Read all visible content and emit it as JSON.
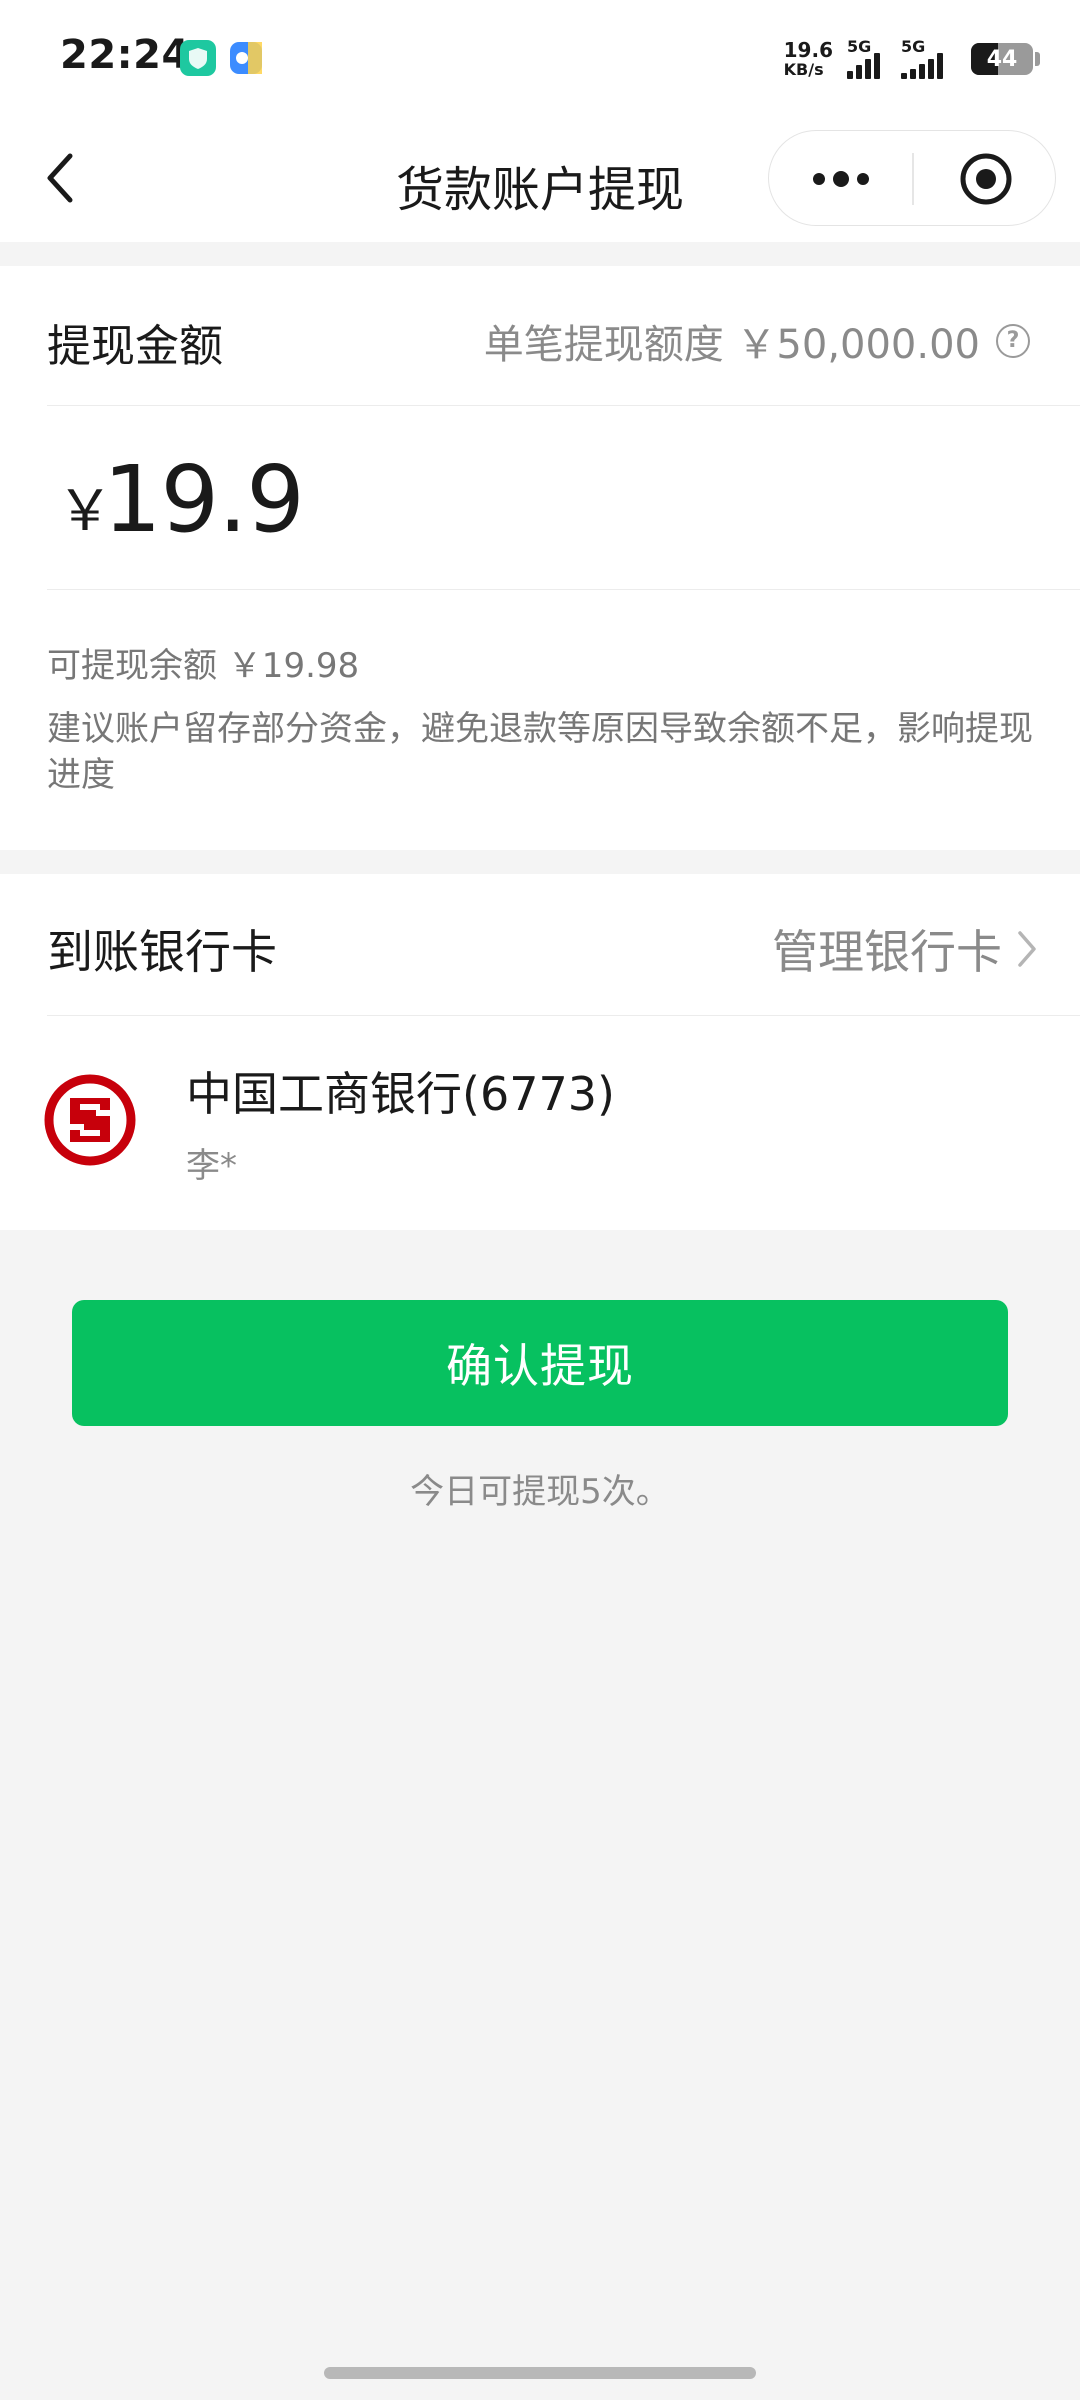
{
  "status_bar": {
    "time": "22:24",
    "net_speed_value": "19.6",
    "net_speed_unit": "KB/s",
    "sim1_label": "5G",
    "sim2_label": "5G",
    "battery_level": "44",
    "battery_fraction": 0.44,
    "app_icons": [
      "green-shield-app-icon",
      "blue-app-icon"
    ]
  },
  "nav": {
    "title": "货款账户提现",
    "back_icon": "chevron-left-icon",
    "more_icon": "more-dots-icon",
    "close_icon": "target-circle-icon"
  },
  "withdraw": {
    "label": "提现金额",
    "limit_label": "单笔提现额度 ￥50,000.00",
    "amount_symbol": "￥",
    "amount_value": "19.9",
    "balance_label": "可提现余额 ￥19.98",
    "advice": "建议账户留存部分资金，避免退款等原因导致余额不足，影响提现进度"
  },
  "bank": {
    "label": "到账银行卡",
    "manage_label": "管理银行卡",
    "card_name": "中国工商银行(6773)",
    "holder": "李*",
    "logo_icon": "icbc-logo-icon",
    "logo_color": "#c7000b"
  },
  "actions": {
    "confirm_label": "确认提现",
    "remaining_text": "今日可提现5次。"
  },
  "colors": {
    "primary": "#07c160",
    "background": "#f4f4f4",
    "secondary_text": "#8a8a8a"
  }
}
